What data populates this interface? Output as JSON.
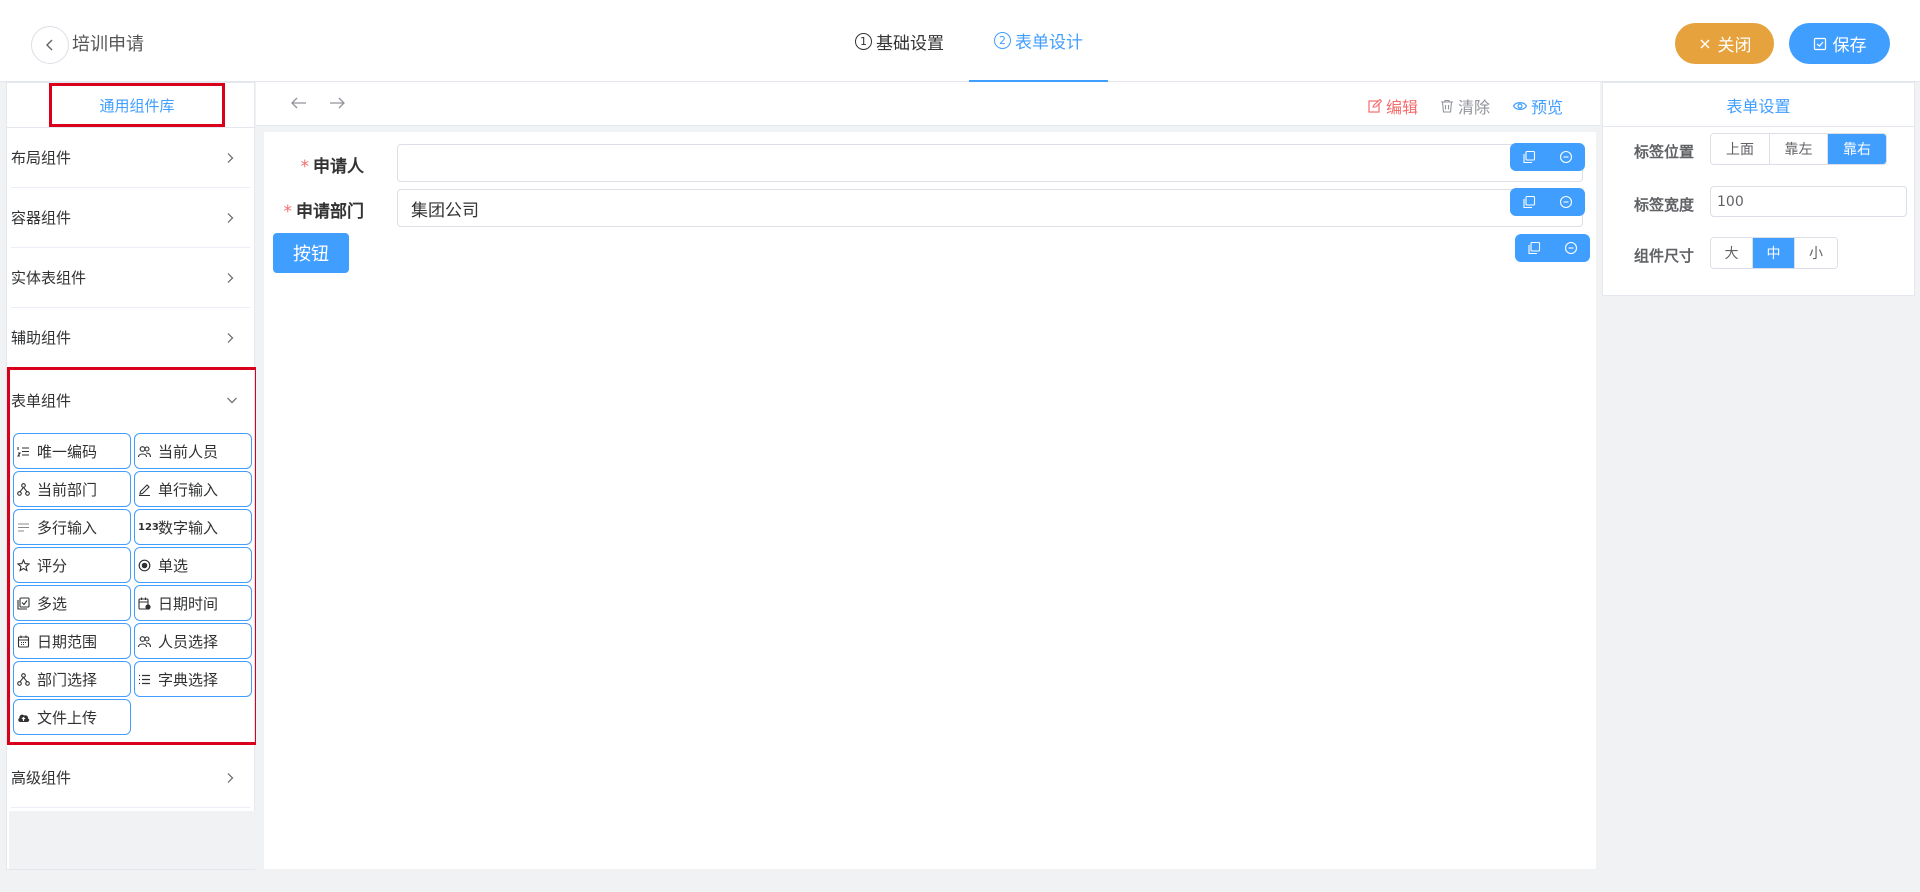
{
  "header": {
    "title": "培训申请",
    "steps": [
      {
        "num": "1",
        "label": "基础设置"
      },
      {
        "num": "2",
        "label": "表单设计"
      }
    ],
    "close_label": "关闭",
    "save_label": "保存",
    "colors": {
      "accent": "#409eff",
      "close": "#e6a23c",
      "highlight_border": "#d9001b"
    }
  },
  "left_panel": {
    "tab_label": "通用组件库",
    "categories": [
      {
        "label": "布局组件"
      },
      {
        "label": "容器组件"
      },
      {
        "label": "实体表组件"
      },
      {
        "label": "辅助组件"
      },
      {
        "label": "表单组件"
      },
      {
        "label": "高级组件"
      }
    ],
    "form_components": [
      {
        "label": "唯一编码",
        "icon": "list-number-icon"
      },
      {
        "label": "当前人员",
        "icon": "users-icon"
      },
      {
        "label": "当前部门",
        "icon": "org-icon"
      },
      {
        "label": "单行输入",
        "icon": "pen-icon"
      },
      {
        "label": "多行输入",
        "icon": "lines-icon"
      },
      {
        "label": "数字输入",
        "icon": "number-icon",
        "glyph": "123"
      },
      {
        "label": "评分",
        "icon": "star-icon"
      },
      {
        "label": "单选",
        "icon": "radio-icon"
      },
      {
        "label": "多选",
        "icon": "checkbox-icon"
      },
      {
        "label": "日期时间",
        "icon": "calendar-clock-icon"
      },
      {
        "label": "日期范围",
        "icon": "calendar-icon"
      },
      {
        "label": "人员选择",
        "icon": "users-icon"
      },
      {
        "label": "部门选择",
        "icon": "org-icon"
      },
      {
        "label": "字典选择",
        "icon": "list-icon"
      },
      {
        "label": "文件上传",
        "icon": "cloud-upload-icon"
      }
    ]
  },
  "toolbar": {
    "edit_label": "编辑",
    "clear_label": "清除",
    "preview_label": "预览"
  },
  "form": {
    "fields": [
      {
        "label": "申请人",
        "required": "*",
        "value": ""
      },
      {
        "label": "申请部门",
        "required": "*",
        "value": "集团公司"
      }
    ],
    "button_label": "按钮"
  },
  "right_panel": {
    "tab_label": "表单设置",
    "label_position": {
      "label": "标签位置",
      "options": [
        "上面",
        "靠左",
        "靠右"
      ],
      "selected": "靠右"
    },
    "label_width": {
      "label": "标签宽度",
      "value": "100"
    },
    "component_size": {
      "label": "组件尺寸",
      "options": [
        "大",
        "中",
        "小"
      ],
      "selected": "中"
    }
  }
}
